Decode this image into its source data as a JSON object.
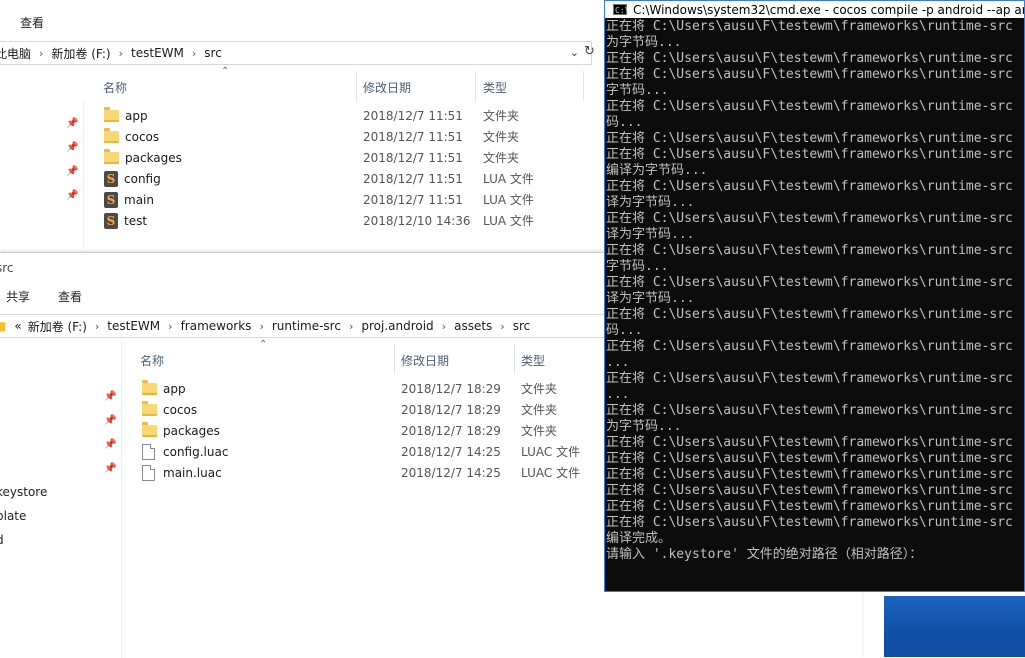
{
  "explorer_top": {
    "ribbon_tab": "查看",
    "breadcrumb": [
      "此电脑",
      "新加卷 (F:)",
      "testEWM",
      "src"
    ],
    "columns": {
      "name": "名称",
      "date": "修改日期",
      "type": "类型"
    },
    "files": [
      {
        "icon": "folder-icon",
        "name": "app",
        "date": "2018/12/7 11:51",
        "type": "文件夹"
      },
      {
        "icon": "folder-icon",
        "name": "cocos",
        "date": "2018/12/7 11:51",
        "type": "文件夹"
      },
      {
        "icon": "folder-icon",
        "name": "packages",
        "date": "2018/12/7 11:51",
        "type": "文件夹"
      },
      {
        "icon": "lua-file-icon",
        "name": "config",
        "date": "2018/12/7 11:51",
        "type": "LUA 文件"
      },
      {
        "icon": "lua-file-icon",
        "name": "main",
        "date": "2018/12/7 11:51",
        "type": "LUA 文件"
      },
      {
        "icon": "lua-file-icon",
        "name": "test",
        "date": "2018/12/10 14:36",
        "type": "LUA 文件"
      }
    ]
  },
  "explorer_bottom": {
    "window_title": "src",
    "ribbon_tabs": [
      "共享",
      "查看"
    ],
    "breadcrumb_prefix": "«",
    "breadcrumb": [
      "新加卷 (F:)",
      "testEWM",
      "frameworks",
      "runtime-src",
      "proj.android",
      "assets",
      "src"
    ],
    "columns": {
      "name": "名称",
      "date": "修改日期",
      "type": "类型"
    },
    "files": [
      {
        "icon": "folder-icon",
        "name": "app",
        "date": "2018/12/7 18:29",
        "type": "文件夹"
      },
      {
        "icon": "folder-icon",
        "name": "cocos",
        "date": "2018/12/7 18:29",
        "type": "文件夹"
      },
      {
        "icon": "folder-icon",
        "name": "packages",
        "date": "2018/12/7 18:29",
        "type": "文件夹"
      },
      {
        "icon": "file-icon",
        "name": "config.luac",
        "date": "2018/12/7 14:25",
        "type": "LUAC 文件"
      },
      {
        "icon": "file-icon",
        "name": "main.luac",
        "date": "2018/12/7 14:25",
        "type": "LUAC 文件"
      }
    ],
    "nav_items": [
      "keystore",
      "plate",
      "d"
    ]
  },
  "cmd": {
    "title": "C:\\Windows\\system32\\cmd.exe - cocos  compile -p android --ap an",
    "lines": [
      "正在将 C:\\Users\\ausu\\F\\testewm\\frameworks\\runtime-src",
      "为字节码...",
      "正在将 C:\\Users\\ausu\\F\\testewm\\frameworks\\runtime-src",
      "正在将 C:\\Users\\ausu\\F\\testewm\\frameworks\\runtime-src",
      "字节码...",
      "正在将 C:\\Users\\ausu\\F\\testewm\\frameworks\\runtime-src",
      "码...",
      "正在将 C:\\Users\\ausu\\F\\testewm\\frameworks\\runtime-src",
      "正在将 C:\\Users\\ausu\\F\\testewm\\frameworks\\runtime-src",
      "编译为字节码...",
      "正在将 C:\\Users\\ausu\\F\\testewm\\frameworks\\runtime-src",
      "译为字节码...",
      "正在将 C:\\Users\\ausu\\F\\testewm\\frameworks\\runtime-src",
      "译为字节码...",
      "正在将 C:\\Users\\ausu\\F\\testewm\\frameworks\\runtime-src",
      "字节码...",
      "正在将 C:\\Users\\ausu\\F\\testewm\\frameworks\\runtime-src",
      "译为字节码...",
      "正在将 C:\\Users\\ausu\\F\\testewm\\frameworks\\runtime-src",
      "码...",
      "正在将 C:\\Users\\ausu\\F\\testewm\\frameworks\\runtime-src",
      "...",
      "正在将 C:\\Users\\ausu\\F\\testewm\\frameworks\\runtime-src",
      "...",
      "正在将 C:\\Users\\ausu\\F\\testewm\\frameworks\\runtime-src",
      "为字节码...",
      "正在将 C:\\Users\\ausu\\F\\testewm\\frameworks\\runtime-src",
      "正在将 C:\\Users\\ausu\\F\\testewm\\frameworks\\runtime-src",
      "正在将 C:\\Users\\ausu\\F\\testewm\\frameworks\\runtime-src",
      "正在将 C:\\Users\\ausu\\F\\testewm\\frameworks\\runtime-src",
      "正在将 C:\\Users\\ausu\\F\\testewm\\frameworks\\runtime-src",
      "正在将 C:\\Users\\ausu\\F\\testewm\\frameworks\\runtime-src",
      "编译完成。",
      "请输入 '.keystore' 文件的绝对路径（相对路径）："
    ]
  },
  "colors": {
    "folder": "#f8d775",
    "console_bg": "#0c0c0c",
    "console_text": "#c0c0c0",
    "desktop_blue": "#0f4ea3",
    "window_border": "#3a7bd5"
  }
}
